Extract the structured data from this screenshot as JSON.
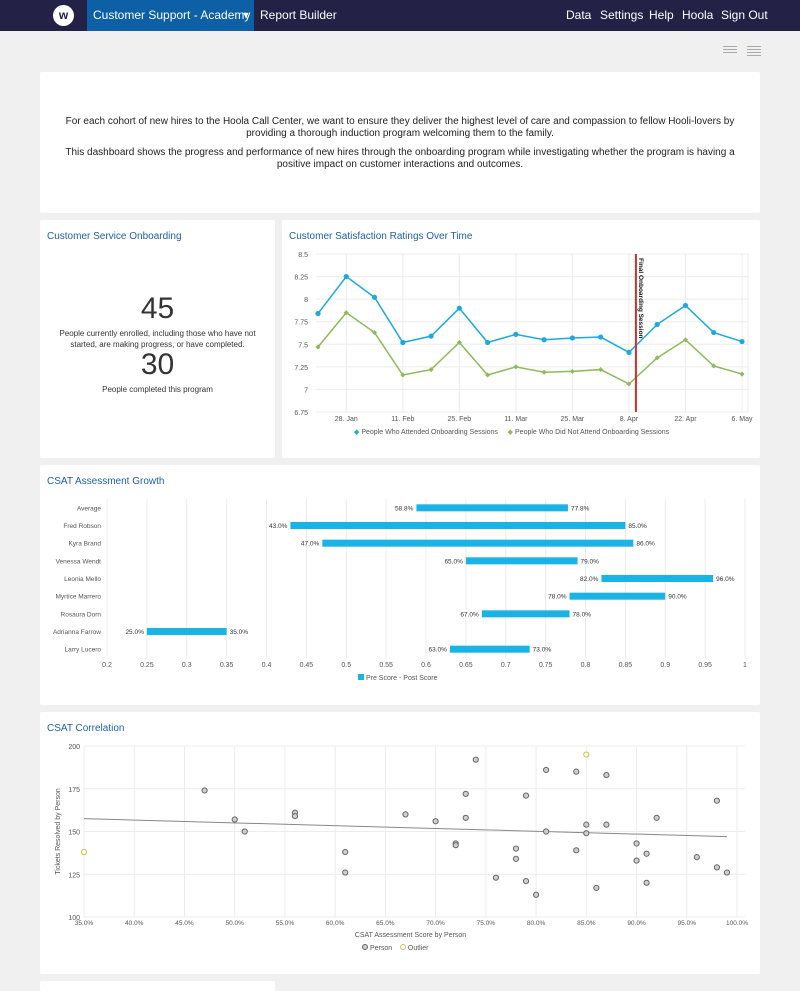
{
  "nav": {
    "logo_letter": "w",
    "app_selector": "Customer Support - Academy",
    "report_builder": "Report Builder",
    "links": [
      "Data",
      "Settings",
      "Help",
      "Hoola",
      "Sign Out"
    ]
  },
  "toolbar": {
    "icons": [
      "filter-lines-icon",
      "list-view-icon"
    ]
  },
  "intro": {
    "paragraph_1": "For each cohort of new hires to the Hoola Call Center, we want to ensure they deliver the highest level of care and compassion to fellow Hooli-lovers by providing a thorough induction program welcoming them to the family.",
    "paragraph_2": "This dashboard shows the progress and performance of new hires through the onboarding program while investigating whether the program is having a positive impact on customer interactions and outcomes."
  },
  "onboarding": {
    "title": "Customer Service Onboarding",
    "enrolled_value": "45",
    "enrolled_label": "People currently enrolled, including those who have not started, are making progress, or have completed.",
    "completed_value": "30",
    "completed_label": "People completed this program"
  },
  "chart_data": [
    {
      "type": "line",
      "title": "Customer Satisfaction Ratings Over Time",
      "xlabel": "",
      "ylabel": "",
      "x_tick_labels": [
        "28. Jan",
        "11. Feb",
        "25. Feb",
        "11. Mar",
        "25. Mar",
        "8. Apr",
        "22. Apr",
        "6. May"
      ],
      "y_ticks": [
        6.75,
        7,
        7.25,
        7.5,
        7.75,
        8,
        8.25,
        8.5
      ],
      "ylim": [
        6.75,
        8.5
      ],
      "x_dates": [
        "21 Jan",
        "28 Jan",
        "4 Feb",
        "11 Feb",
        "18 Feb",
        "25 Feb",
        "4 Mar",
        "11 Mar",
        "18 Mar",
        "25 Mar",
        "1 Apr",
        "8 Apr",
        "15 Apr",
        "22 Apr",
        "29 Apr",
        "6 May"
      ],
      "series": [
        {
          "name": "People Who Attended Onboarding Sessions",
          "color": "#1ba9df",
          "marker": "circle",
          "values": [
            7.84,
            8.25,
            8.02,
            7.52,
            7.59,
            7.9,
            7.52,
            7.61,
            7.55,
            7.57,
            7.58,
            7.41,
            7.72,
            7.93,
            7.63,
            7.53
          ]
        },
        {
          "name": "People Who Did Not Attend Onboarding Sessions",
          "color": "#8dba5a",
          "marker": "diamond",
          "values": [
            7.47,
            7.85,
            7.63,
            7.16,
            7.22,
            7.52,
            7.16,
            7.25,
            7.19,
            7.2,
            7.22,
            7.06,
            7.35,
            7.55,
            7.26,
            7.17
          ]
        }
      ],
      "annotations": [
        {
          "type": "vertical-line",
          "at": "~9 Apr",
          "label": "Final Onboarding Session",
          "color": "#d22f2f"
        }
      ],
      "legend": "bottom",
      "grid": true
    },
    {
      "type": "bar",
      "subtype": "range-bar-horizontal",
      "title": "CSAT Assessment Growth",
      "categories": [
        "Average",
        "Fred Robson",
        "Kyra Brand",
        "Venessa Wendt",
        "Leonia Mello",
        "Myrtice Marrero",
        "Rosaura Dorn",
        "Adrianna Farrow",
        "Larry Lucero"
      ],
      "series": [
        {
          "name": "Pre Score - Post Score",
          "color": "#1ab3e6",
          "low": [
            0.588,
            0.43,
            0.47,
            0.65,
            0.82,
            0.78,
            0.67,
            0.25,
            0.63
          ],
          "high": [
            0.778,
            0.85,
            0.86,
            0.79,
            0.96,
            0.9,
            0.78,
            0.35,
            0.73
          ],
          "low_labels": [
            "58.8%",
            "43.0%",
            "47.0%",
            "65.0%",
            "82.0%",
            "78.0%",
            "67.0%",
            "25.0%",
            "63.0%"
          ],
          "high_labels": [
            "77.8%",
            "85.0%",
            "86.0%",
            "79.0%",
            "96.0%",
            "90.0%",
            "78.0%",
            "35.0%",
            "73.0%"
          ]
        }
      ],
      "x_ticks": [
        "0.2",
        "0.25",
        "0.3",
        "0.35",
        "0.4",
        "0.45",
        "0.5",
        "0.55",
        "0.6",
        "0.65",
        "0.7",
        "0.75",
        "0.8",
        "0.85",
        "0.9",
        "0.95",
        "1"
      ],
      "xlim": [
        0.2,
        1
      ],
      "legend": "bottom",
      "grid": true
    },
    {
      "type": "scatter",
      "title": "CSAT Correlation",
      "xlabel": "CSAT Assessment Score by Person",
      "ylabel": "Tickets Resolved by Person",
      "x_ticks": [
        "35.0%",
        "40.0%",
        "45.0%",
        "50.0%",
        "55.0%",
        "60.0%",
        "65.0%",
        "70.0%",
        "75.0%",
        "80.0%",
        "85.0%",
        "90.0%",
        "95.0%",
        "100.0%"
      ],
      "y_ticks": [
        "100",
        "125",
        "150",
        "175",
        "200"
      ],
      "xlim": [
        35,
        100
      ],
      "ylim": [
        100,
        200
      ],
      "series": [
        {
          "name": "Person",
          "color": "#999999",
          "points": [
            [
              47,
              174
            ],
            [
              50,
              157
            ],
            [
              51,
              150
            ],
            [
              56,
              161
            ],
            [
              56,
              159
            ],
            [
              61,
              138
            ],
            [
              61,
              126
            ],
            [
              67,
              160
            ],
            [
              70,
              156
            ],
            [
              72,
              143
            ],
            [
              72,
              142
            ],
            [
              73,
              172
            ],
            [
              73,
              158
            ],
            [
              74,
              192
            ],
            [
              76,
              123
            ],
            [
              78,
              140
            ],
            [
              78,
              134
            ],
            [
              79,
              171
            ],
            [
              79,
              121
            ],
            [
              80,
              113
            ],
            [
              81,
              186
            ],
            [
              81,
              150
            ],
            [
              84,
              185
            ],
            [
              84,
              139
            ],
            [
              85,
              154
            ],
            [
              85,
              149
            ],
            [
              86,
              117
            ],
            [
              87,
              183
            ],
            [
              87,
              154
            ],
            [
              90,
              143
            ],
            [
              90,
              133
            ],
            [
              91,
              137
            ],
            [
              91,
              120
            ],
            [
              92,
              158
            ],
            [
              96,
              135
            ],
            [
              98,
              168
            ],
            [
              98,
              129
            ],
            [
              99,
              126
            ]
          ]
        },
        {
          "name": "Outlier",
          "color": "#c9c25a",
          "points": [
            [
              35,
              138
            ],
            [
              85,
              195
            ]
          ]
        }
      ],
      "trendline": {
        "from": [
          35,
          157.5
        ],
        "to": [
          99,
          147
        ]
      },
      "legend": "bottom",
      "grid": true
    }
  ]
}
